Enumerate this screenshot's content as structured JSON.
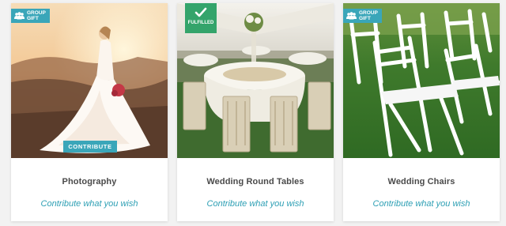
{
  "badges": {
    "group_gift_line1": "GROUP",
    "group_gift_line2": "GIFT",
    "fulfilled": "FULFILLED"
  },
  "colors": {
    "accent_teal": "#3aa6b9",
    "fulfilled_green": "#34a46b",
    "link_teal": "#2d9fb4",
    "title_gray": "#4a4a4a"
  },
  "cards": [
    {
      "title": "Photography",
      "link": "Contribute what you wish",
      "contribute_button": "CONTRIBUTE",
      "badge": "group-gift",
      "icon": "group-icon"
    },
    {
      "title": "Wedding Round Tables",
      "link": "Contribute what you wish",
      "badge": "fulfilled",
      "icon": "check-icon"
    },
    {
      "title": "Wedding Chairs",
      "link": "Contribute what you wish",
      "badge": "group-gift",
      "icon": "group-icon"
    }
  ]
}
